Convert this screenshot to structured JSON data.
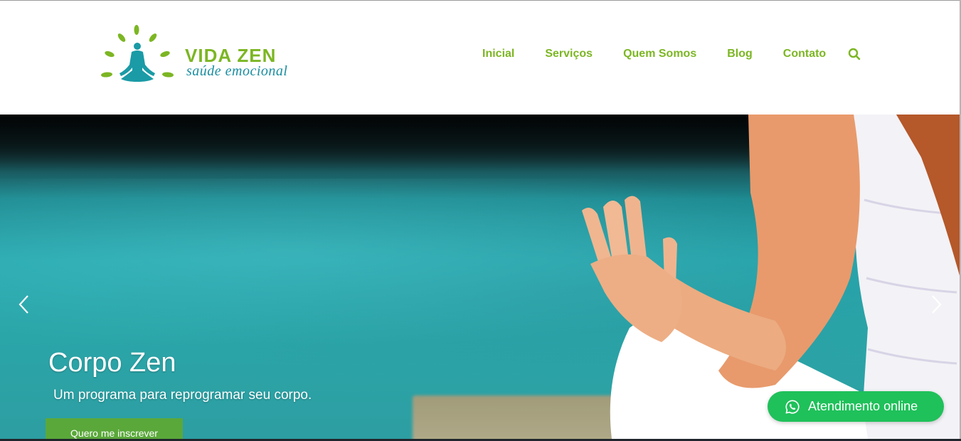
{
  "brand": {
    "name": "VIDA ZEN",
    "tagline": "saúde emocional"
  },
  "nav": {
    "items": [
      {
        "label": "Inicial"
      },
      {
        "label": "Serviços"
      },
      {
        "label": "Quem Somos"
      },
      {
        "label": "Blog"
      },
      {
        "label": "Contato"
      }
    ],
    "search_icon": "search-icon"
  },
  "hero": {
    "title": "Corpo Zen",
    "subtitle": "Um programa para reprogramar seu corpo.",
    "cta_label": "Quero me inscrever",
    "prev_icon": "chevron-left-icon",
    "next_icon": "chevron-right-icon"
  },
  "chat": {
    "label": "Atendimento online",
    "icon": "whatsapp-icon"
  },
  "colors": {
    "brand_green": "#7cb623",
    "brand_teal": "#1a8ea0",
    "cta_green": "#5aa83a",
    "whatsapp_green": "#1fc15a"
  }
}
